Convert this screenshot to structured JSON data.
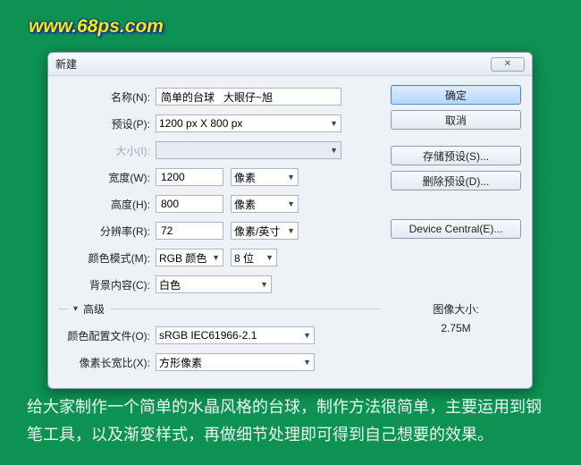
{
  "watermark": "www.68ps.com",
  "dialog": {
    "title": "新建",
    "close_glyph": "✕",
    "ok": "确定",
    "cancel": "取消",
    "save_preset": "存储预设(S)...",
    "delete_preset": "删除预设(D)...",
    "device_central": "Device Central(E)...",
    "image_size_label": "图像大小:",
    "image_size_value": "2.75M",
    "advanced_label": "高级",
    "fields": {
      "name_label": "名称(N):",
      "name_value": "简单的台球   大眼仔~旭",
      "preset_label": "预设(P):",
      "preset_value": "1200 px X 800 px",
      "size_label": "大小(I):",
      "size_value": "",
      "width_label": "宽度(W):",
      "width_value": "1200",
      "width_unit": "像素",
      "height_label": "高度(H):",
      "height_value": "800",
      "height_unit": "像素",
      "res_label": "分辨率(R):",
      "res_value": "72",
      "res_unit": "像素/英寸",
      "mode_label": "颜色模式(M):",
      "mode_value": "RGB 颜色",
      "bit_value": "8 位",
      "bg_label": "背景内容(C):",
      "bg_value": "白色",
      "profile_label": "颜色配置文件(O):",
      "profile_value": "sRGB IEC61966-2.1",
      "aspect_label": "像素长宽比(X):",
      "aspect_value": "方形像素"
    }
  },
  "caption": "给大家制作一个简单的水晶风格的台球，制作方法很简单，主要运用到钢笔工具，以及渐变样式，再做细节处理即可得到自己想要的效果。"
}
